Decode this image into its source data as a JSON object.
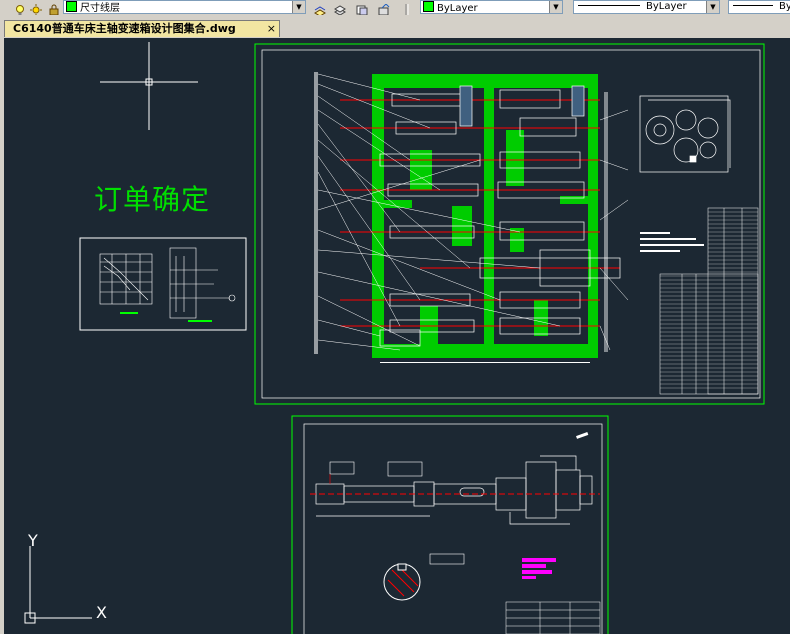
{
  "toolbar": {
    "layer_name": "尺寸线层",
    "color_value": "ByLayer",
    "linetype_value": "ByLayer",
    "lineweight_value": "By",
    "layer_color": "#00ff00"
  },
  "document": {
    "tab_title": "C6140普通车床主轴变速箱设计图集合.dwg",
    "close_glyph": "×"
  },
  "canvas": {
    "text_annotation": "订单确定",
    "ucs_x": "X",
    "ucs_y": "Y"
  },
  "colors": {
    "canvas_bg": "#1c2833",
    "frame_green": "#00ff00",
    "line_white": "#ffffff",
    "line_red": "#ff0000",
    "fill_green": "#00cc00",
    "magenta": "#ff00ff"
  }
}
